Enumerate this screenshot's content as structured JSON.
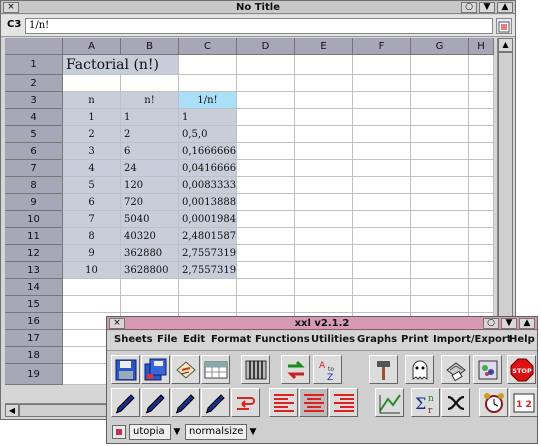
{
  "main_window": {
    "title": "No Title",
    "cell_ref": "C3",
    "formula": "1/n!"
  },
  "sheet": {
    "columns": [
      "A",
      "B",
      "C",
      "D",
      "E",
      "F",
      "G",
      "H"
    ],
    "rows": [
      "1",
      "2",
      "3",
      "4",
      "5",
      "6",
      "7",
      "8",
      "9",
      "10",
      "11",
      "12",
      "13",
      "14",
      "15",
      "16",
      "17",
      "18",
      "19"
    ],
    "title_cell": "Factorial (n!)",
    "headers": {
      "n": "n",
      "fact": "n!",
      "inv": "1/n!"
    },
    "data": [
      {
        "n": "1",
        "fact": "1",
        "inv": "1"
      },
      {
        "n": "2",
        "fact": "2",
        "inv": "0,5,0"
      },
      {
        "n": "3",
        "fact": "6",
        "inv": "0,166666666"
      },
      {
        "n": "4",
        "fact": "24",
        "inv": "0,041666666"
      },
      {
        "n": "5",
        "fact": "120",
        "inv": "0,008333333"
      },
      {
        "n": "6",
        "fact": "720",
        "inv": "0,001388888"
      },
      {
        "n": "7",
        "fact": "5040",
        "inv": "0,000198412"
      },
      {
        "n": "8",
        "fact": "40320",
        "inv": "2,480158730"
      },
      {
        "n": "9",
        "fact": "362880",
        "inv": "2,755731922"
      },
      {
        "n": "10",
        "fact": "3628800",
        "inv": "2,755731922"
      }
    ]
  },
  "toolbar_window": {
    "title": "xxl v2.1.2",
    "menu": [
      "Sheets",
      "File",
      "Edit",
      "Format",
      "Functions",
      "Utilities",
      "Graphs",
      "Print",
      "Import/Export",
      "Help"
    ],
    "font_name": "utopia",
    "font_size": "normalsize",
    "sort_icon_text": {
      "top": "A",
      "to": "to",
      "bottom": "Z"
    },
    "stop_text": "STOP",
    "sum_sigma": "Σ",
    "sum_n": "n",
    "sum_r": "r",
    "chart_numbers": "1 2"
  },
  "colors": {
    "header_bg": "#a7a7b8",
    "shaded_cell": "#c7cdd9",
    "selected_cell": "#a9e0f8",
    "toolbar_title": "#d79ab4"
  },
  "icons": {
    "close": "×",
    "chevron_down": "▼",
    "chevron_up": "▲",
    "chevron_left": "◀",
    "chevron_right": "▶",
    "circle": "○",
    "dropdown_arrow": "▼"
  }
}
